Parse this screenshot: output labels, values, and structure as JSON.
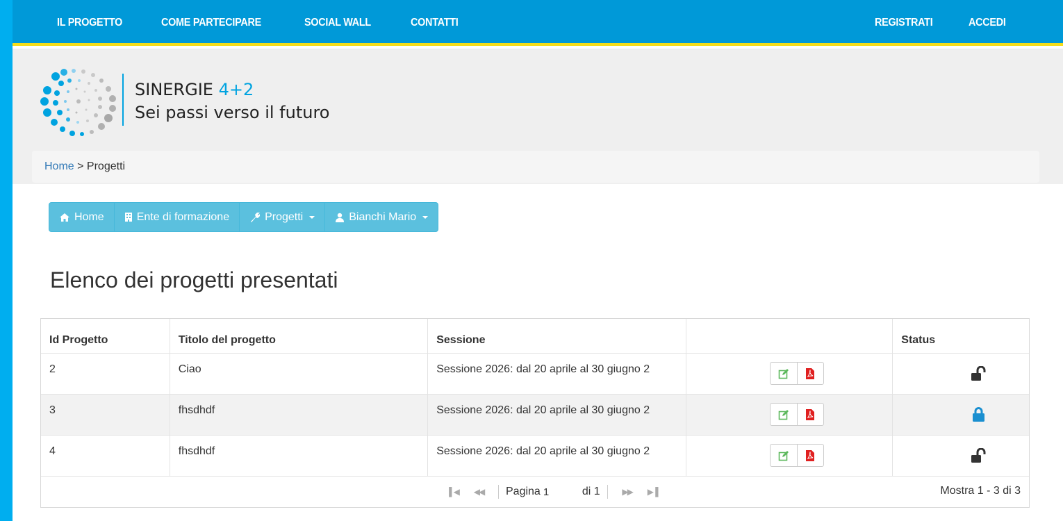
{
  "topnav": {
    "left": [
      "IL PROGETTO",
      "COME PARTECIPARE",
      "SOCIAL WALL",
      "CONTATTI"
    ],
    "right": [
      "REGISTRATI",
      "ACCEDI"
    ]
  },
  "brand": {
    "line1_prefix": "SINERGIE",
    "line1_number": "4+2",
    "line2": "Sei passi verso il futuro"
  },
  "breadcrumb": {
    "home": "Home",
    "separator": " > ",
    "current": "Progetti"
  },
  "toolbar": {
    "home": {
      "label": "Home",
      "icon": "home-icon"
    },
    "ente": {
      "label": "Ente di formazione",
      "icon": "building-icon"
    },
    "progetti": {
      "label": "Progetti",
      "icon": "wrench-icon"
    },
    "user": {
      "label": "Bianchi Mario",
      "icon": "user-icon"
    }
  },
  "page_title": "Elenco dei progetti presentati",
  "table": {
    "headers": [
      "Id Progetto",
      "Titolo del progetto",
      "Sessione",
      "",
      "Status"
    ],
    "rows": [
      {
        "id": "2",
        "titolo": "Ciao",
        "sessione": "Sessione 2026: dal 20 aprile al 30 giugno 2",
        "status": "unlocked"
      },
      {
        "id": "3",
        "titolo": "fhsdhdf",
        "sessione": "Sessione 2026: dal 20 aprile al 30 giugno 2",
        "status": "locked"
      },
      {
        "id": "4",
        "titolo": "fhsdhdf",
        "sessione": "Sessione 2026: dal 20 aprile al 30 giugno 2",
        "status": "unlocked"
      }
    ]
  },
  "pager": {
    "page_label": "Pagina",
    "page_value": "1",
    "of_label": "di 1",
    "summary": "Mostra 1 - 3 di 3"
  },
  "colors": {
    "outer_frame": "#00aeef",
    "topnav": "#0099d8",
    "accent_yellow": "#f5dd1a",
    "toolbar": "#5bc0de",
    "lock_blue": "#1a8fd0",
    "edit_green": "#5cb85c",
    "pdf_red": "#e02020"
  }
}
